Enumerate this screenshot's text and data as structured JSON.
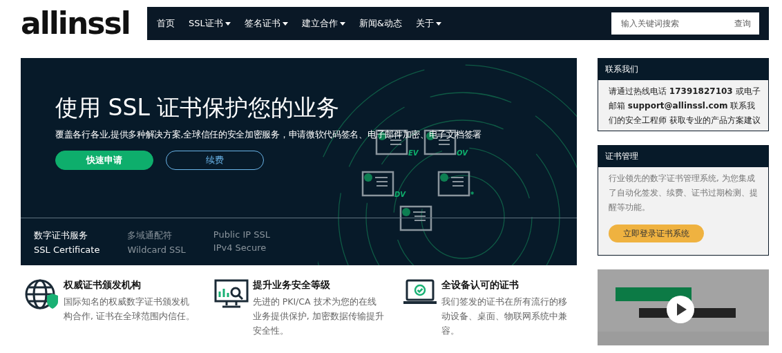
{
  "logo": {
    "text": "allinssl"
  },
  "nav": {
    "items": [
      {
        "label": "首页",
        "dropdown": false
      },
      {
        "label": "SSL证书",
        "dropdown": true
      },
      {
        "label": "签名证书",
        "dropdown": true
      },
      {
        "label": "建立合作",
        "dropdown": true
      },
      {
        "label": "新闻&动态",
        "dropdown": false
      },
      {
        "label": "关于",
        "dropdown": true
      }
    ],
    "search": {
      "placeholder": "输入关键词搜索",
      "button": "查询"
    }
  },
  "hero": {
    "title": "使用 SSL 证书保护您的业务",
    "subtitle": "覆盖各行各业,提供多种解决方案,全球信任的安全加密服务，申请微软代码签名、电子邮件加密、电子文档签署",
    "buttons": [
      {
        "label": "快速申请",
        "kind": "primary"
      },
      {
        "label": "续费",
        "kind": "outline"
      }
    ],
    "certificates": [
      {
        "label": "EV"
      },
      {
        "label": "OV"
      },
      {
        "label": "DV"
      },
      {
        "label": "*"
      }
    ],
    "tabs": [
      {
        "title": "数字证书服务",
        "subtitle": "SSL Certificate",
        "selected": true
      },
      {
        "title": "多域通配符",
        "subtitle": "Wildcard SSL",
        "selected": false
      },
      {
        "title": "Public IP SSL",
        "subtitle": "IPv4 Secure",
        "selected": false
      }
    ]
  },
  "features": [
    {
      "title": "权威证书颁发机构",
      "text": "国际知名的权威数字证书颁发机构合作, 证书在全球范围内信任。"
    },
    {
      "title": "提升业务安全等级",
      "text": "先进的 PKI/CA 技术为您的在线业务提供保护, 加密数据传输提升安全性。"
    },
    {
      "title": "全设备认可的证书",
      "text": "我们签发的证书在所有流行的移动设备、桌面、物联网系统中兼容。"
    }
  ],
  "sidebar": {
    "contact": {
      "title": "联系我们",
      "text": "请通过热线电话 **17391827103** 或电子邮箱 **support@allinssl.com** 联系我们的安全工程师 获取专业的产品方案建议"
    },
    "management": {
      "title": "证书管理",
      "text": "行业领先的数字证书管理系统, 为您集成了自动化签发、续费、证书过期检测、提醒等功能。",
      "button": "立即登录证书系统"
    }
  }
}
